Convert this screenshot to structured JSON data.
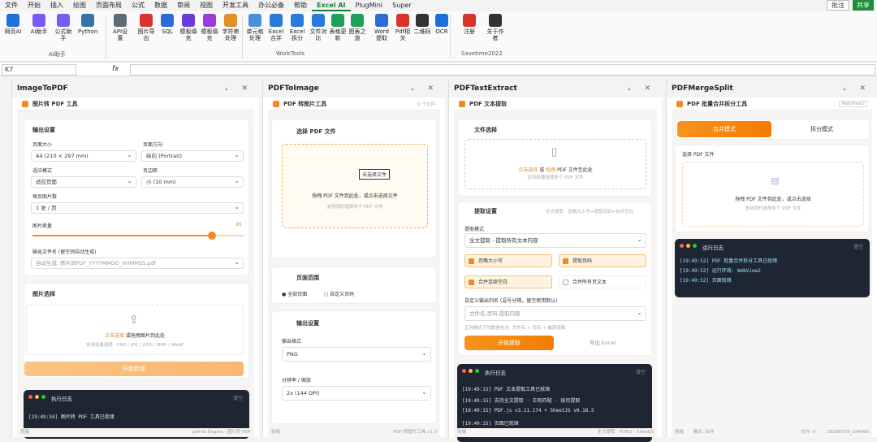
{
  "menu": {
    "tabs": [
      "文件",
      "开始",
      "插入",
      "绘图",
      "页面布局",
      "公式",
      "数据",
      "审阅",
      "视图",
      "开发工具",
      "办公必备",
      "帮助",
      "Excel AI",
      "PlugMini",
      "Super"
    ],
    "active": "Excel AI",
    "annot": "批注",
    "share": "共享"
  },
  "ribbon": {
    "items": [
      {
        "label": "网页AI",
        "color": "#1e6fd9"
      },
      {
        "label": "AI助手",
        "color": "#7a5af5"
      },
      {
        "label": "公式助手",
        "color": "#7a5af5"
      },
      {
        "label": "Python",
        "color": "#3572a5"
      },
      {
        "label": "API设置",
        "color": "#5a6b7a"
      },
      {
        "label": "图片导出",
        "color": "#d9342b"
      },
      {
        "label": "SQL",
        "color": "#2b6cd9"
      },
      {
        "label": "模板填充",
        "color": "#6b3bd9"
      },
      {
        "label": "模板填充",
        "color": "#9b3bd9"
      },
      {
        "label": "字符串处理",
        "color": "#e0902a"
      },
      {
        "label": "单元格处理",
        "color": "#4a90d9"
      },
      {
        "label": "Excel合并",
        "color": "#2b7ad9"
      },
      {
        "label": "Excel拆分",
        "color": "#2b7ad9"
      },
      {
        "label": "文件对比",
        "color": "#2b7ad9"
      },
      {
        "label": "表格更新",
        "color": "#1ea05a"
      },
      {
        "label": "图表之道",
        "color": "#1ea05a"
      },
      {
        "label": "Word提取",
        "color": "#2b6cd9"
      },
      {
        "label": "Pdf相关",
        "color": "#d9342b"
      },
      {
        "label": "二维码",
        "color": "#333333"
      },
      {
        "label": "OCR",
        "color": "#1e6fd9"
      },
      {
        "label": "注册",
        "color": "#d9342b"
      },
      {
        "label": "关于作者",
        "color": "#333333"
      }
    ],
    "groups": [
      "AI助手",
      "WorkTools",
      "Savetime2022"
    ]
  },
  "formula": {
    "cell": "K7",
    "fx": "fx"
  },
  "panels": [
    {
      "title": "ImageToPDF",
      "sub": "图片转 PDF 工具",
      "output": "输出设置",
      "page_size_label": "页面大小",
      "page_size": "A4 (210 × 297 mm)",
      "orient_label": "页面方向",
      "orient": "纵向 (Portrait)",
      "fit_label": "适应模式",
      "fit": "适应页面",
      "margin_label": "页边距",
      "margin": "小 (10 mm)",
      "perpage_label": "每页图片数",
      "perpage": "1 张 / 页",
      "quality_label": "图片质量",
      "quality": 85,
      "fname_label": "输出文件名 (留空则自动生成)",
      "fname_ph": "自动生成: 图片转PDF_YYYYMMDD_HHMMSS.pdf",
      "pick": "图片选择",
      "drop1": "点击选择",
      "drop2": "或拖拽图片到此处",
      "drop_hint": "支持批量选择 · PNG / JPG / JPEG / BMP / WebP",
      "start": "开始转换",
      "log_title": "执行日志",
      "log_clear": "清空",
      "logs": [
        "[19:49:34] 图片转 PDF 工具已就绪"
      ],
      "status": "就绪",
      "status_r": "pdf-lib Engine · 图片转 PDF"
    },
    {
      "title": "PDFToImage",
      "sub": "PDF 转图片工具",
      "count": "0 个文件",
      "pick": "选择 PDF 文件",
      "filebtn": "未选择文件",
      "drop1": "拖拽 PDF 文件到此处，或点击选择文件",
      "drop_hint": "支持同时选择多个 PDF 文件",
      "range": "页面范围",
      "r1": "全部页面",
      "r2": "自定义页码",
      "outset": "输出设置",
      "fmt_label": "输出格式",
      "fmt": "PNG",
      "res_label": "分辨率 / 缩放",
      "res": "2x (144 DPI)",
      "status": "就绪",
      "status_r": "PDF 转图片工具 v1.0"
    },
    {
      "title": "PDFTextExtract",
      "sub": "PDF 文本提取",
      "pick": "文件选择",
      "drop1": "点击选择",
      "drop_or": "或",
      "drop2": "拖拽",
      "drop3": "PDF 文件至此处",
      "drop_hint": "支持批量选择多个 PDF 文件",
      "set": "提取设置",
      "set_r": "全文提取 · 忽略大小写+提取页码+合并空白",
      "mode_label": "提取模式",
      "mode": "全文提取 - 提取所有文本内容",
      "c1": "忽略大小写",
      "c2": "提取页码",
      "c3": "合并连续空白",
      "c4": "合并所有页文本",
      "col_label": "自定义输出列名 (逗号分隔，留空使用默认)",
      "col_ph": "文件名,页码,提取内容",
      "col_hint": "正则模式下列数量包含: 文件名 + 页码 + 捕获组数",
      "start": "开始提取",
      "export": "导出 Excel",
      "log_title": "执行日志",
      "log_clear": "清空",
      "logs": [
        "[19:49:15] PDF 文本提取工具已就绪",
        "[19:49:15] 支持全文提取 · 正则匹配 · 按页提取",
        "[19:49:15] PDF.js v3.11.174 + SheetJS v0.18.5",
        "[19:49:15] 页面已就绪"
      ],
      "status": "就绪",
      "status_r": "全文提取 · PDF.js · SheetJS"
    },
    {
      "title": "PDFMergeSplit",
      "sub": "PDF 批量合并拆分工具",
      "tag": "WebView2",
      "mode1": "合并模式",
      "mode2": "拆分模式",
      "pick": "选择 PDF 文件",
      "drop1": "拖拽 PDF 文件到此处，或点击选择",
      "drop_hint": "支持同时选择多个 PDF 文件",
      "log_title": "运行日志",
      "log_clear": "清空",
      "logs": [
        "[19:49:52] PDF 批量合并拆分工具已就绪",
        "[19:49:52] 运行环境: WebView2",
        "[19:49:52] 页面就绪"
      ],
      "status": "就绪",
      "status_mid": "模式: 合并",
      "status_r": "文件: 0",
      "status_rr": "28268729_194966"
    }
  ]
}
